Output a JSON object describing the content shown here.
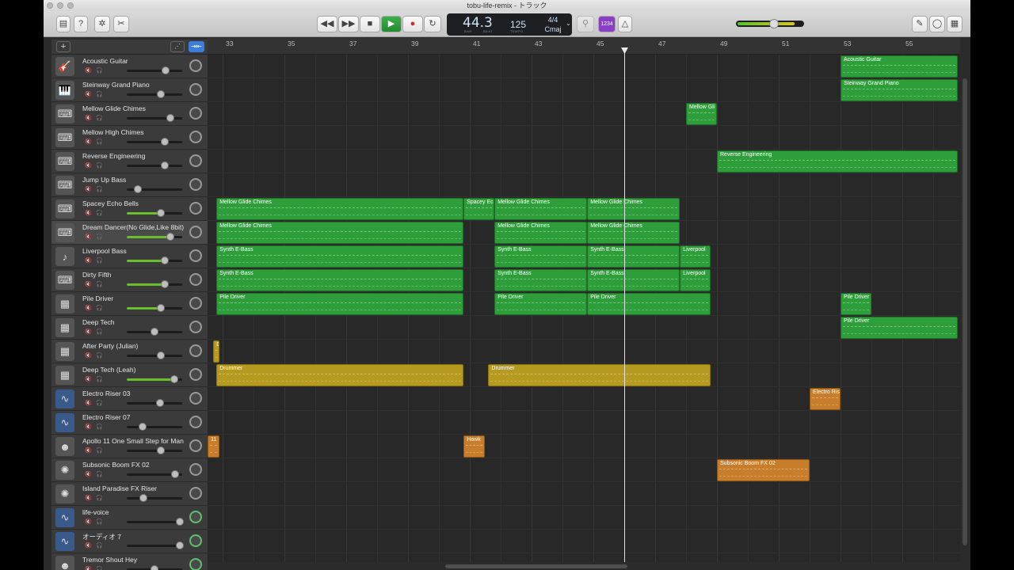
{
  "window": {
    "title": "tobu-life-remix - トラック"
  },
  "lcd": {
    "bar": "44.3",
    "bar_label": "BAR",
    "beat_label": "BEAT",
    "tempo": "125",
    "tempo_label": "TEMPO",
    "signature": "4/4",
    "key": "Cmaj"
  },
  "toolbar": {
    "counter_label": "1234"
  },
  "ruler": {
    "bars": [
      "33",
      "35",
      "37",
      "39",
      "41",
      "43",
      "45",
      "47",
      "49",
      "51",
      "53",
      "55"
    ]
  },
  "tracks": [
    {
      "name": "Acoustic Guitar",
      "icon": "guitar-icon",
      "vol": 0.7
    },
    {
      "name": "Steinway Grand Piano",
      "icon": "piano-icon",
      "vol": 0.62
    },
    {
      "name": "Mellow Glide Chimes",
      "icon": "synth-icon",
      "vol": 0.78
    },
    {
      "name": "Mellow High Chimes",
      "icon": "synth-icon",
      "vol": 0.68
    },
    {
      "name": "Reverse Engineering",
      "icon": "synth-icon",
      "vol": 0.68
    },
    {
      "name": "Jump Up Bass",
      "icon": "synth-icon",
      "vol": 0.2
    },
    {
      "name": "Spacey Echo Bells",
      "icon": "synth-icon",
      "vol": 0.62
    },
    {
      "name": "Dream Dancer(No Glide,Like 8bit)",
      "icon": "synth-icon",
      "vol": 0.78
    },
    {
      "name": "Liverpool Bass",
      "icon": "bass-icon",
      "vol": 0.68
    },
    {
      "name": "Dirty Fifth",
      "icon": "synth-icon",
      "vol": 0.68
    },
    {
      "name": "Pile Driver",
      "icon": "drum-machine-icon",
      "vol": 0.62
    },
    {
      "name": "Deep Tech",
      "icon": "drum-machine-icon",
      "vol": 0.5
    },
    {
      "name": "After Party (Julian)",
      "icon": "drum-machine-icon",
      "vol": 0.62
    },
    {
      "name": "Deep Tech (Leah)",
      "icon": "drum-machine-icon",
      "vol": 0.85
    },
    {
      "name": "Electro Riser 03",
      "icon": "waveform-icon",
      "vol": 0.6
    },
    {
      "name": "Electro Riser 07",
      "icon": "waveform-icon",
      "vol": 0.28
    },
    {
      "name": "Apollo 11 One Small Step for Man",
      "icon": "voice-icon",
      "vol": 0.62
    },
    {
      "name": "Subsonic Boom FX 02",
      "icon": "fx-icon",
      "vol": 0.87
    },
    {
      "name": "Island Paradise FX Riser",
      "icon": "fx-icon",
      "vol": 0.3
    },
    {
      "name": "life-voice",
      "icon": "waveform-icon",
      "vol": 0.95
    },
    {
      "name": "オーディオ 7",
      "icon": "waveform-icon",
      "vol": 0.95
    },
    {
      "name": "Tremor Shout Hey",
      "icon": "voice-icon",
      "vol": 0.5
    }
  ],
  "regions": [
    {
      "track": 0,
      "label": "Acoustic Guitar",
      "color": "green",
      "start": 53.0,
      "end": 56.8
    },
    {
      "track": 1,
      "label": "Steinway Grand Piano",
      "color": "green",
      "start": 53.0,
      "end": 56.8
    },
    {
      "track": 2,
      "label": "Mellow Gli",
      "color": "green",
      "start": 48.0,
      "end": 49.0
    },
    {
      "track": 4,
      "label": "Reverse Engineering",
      "color": "green",
      "start": 49.0,
      "end": 56.8
    },
    {
      "track": 6,
      "label": "Mellow Glide Chimes",
      "color": "green",
      "start": 32.8,
      "end": 40.8
    },
    {
      "track": 6,
      "label": "Spacey Ec",
      "color": "green",
      "start": 40.8,
      "end": 41.8
    },
    {
      "track": 6,
      "label": "Mellow Glide Chimes",
      "color": "green",
      "start": 41.8,
      "end": 44.8
    },
    {
      "track": 6,
      "label": "Mellow Glide Chimes",
      "color": "green",
      "start": 44.8,
      "end": 47.8
    },
    {
      "track": 7,
      "label": "Mellow Glide Chimes",
      "color": "green",
      "start": 32.8,
      "end": 40.8
    },
    {
      "track": 7,
      "label": "Mellow Glide Chimes",
      "color": "green",
      "start": 41.8,
      "end": 44.8
    },
    {
      "track": 7,
      "label": "Mellow Glide Chimes",
      "color": "green",
      "start": 44.8,
      "end": 47.8
    },
    {
      "track": 8,
      "label": "Synth E-Bass",
      "color": "green",
      "start": 32.8,
      "end": 40.8
    },
    {
      "track": 8,
      "label": "Synth E-Bass",
      "color": "green",
      "start": 41.8,
      "end": 44.8
    },
    {
      "track": 8,
      "label": "Synth E-Bass",
      "color": "green",
      "start": 44.8,
      "end": 47.8
    },
    {
      "track": 8,
      "label": "Liverpool",
      "color": "green",
      "start": 47.8,
      "end": 48.8
    },
    {
      "track": 9,
      "label": "Synth E-Bass",
      "color": "green",
      "start": 32.8,
      "end": 40.8
    },
    {
      "track": 9,
      "label": "Synth E-Bass",
      "color": "green",
      "start": 41.8,
      "end": 44.8
    },
    {
      "track": 9,
      "label": "Synth E-Bass",
      "color": "green",
      "start": 44.8,
      "end": 47.8
    },
    {
      "track": 9,
      "label": "Liverpool",
      "color": "green",
      "start": 47.8,
      "end": 48.8
    },
    {
      "track": 10,
      "label": "Pile Driver",
      "color": "green",
      "start": 32.8,
      "end": 40.8
    },
    {
      "track": 10,
      "label": "Pile Driver",
      "color": "green",
      "start": 41.8,
      "end": 44.8
    },
    {
      "track": 10,
      "label": "Pile Driver",
      "color": "green",
      "start": 44.8,
      "end": 48.8
    },
    {
      "track": 10,
      "label": "Pile Driver",
      "color": "green",
      "start": 53.0,
      "end": 54.0
    },
    {
      "track": 11,
      "label": "Pile Driver",
      "color": "green",
      "start": 53.0,
      "end": 56.8
    },
    {
      "track": 12,
      "label": "D",
      "color": "yellow",
      "start": 32.7,
      "end": 32.9
    },
    {
      "track": 13,
      "label": "Drummer",
      "color": "yellow",
      "start": 32.8,
      "end": 40.8
    },
    {
      "track": 13,
      "label": "Drummer",
      "color": "yellow",
      "start": 41.6,
      "end": 48.8
    },
    {
      "track": 14,
      "label": "Electro Ris",
      "color": "orange",
      "start": 52.0,
      "end": 53.0
    },
    {
      "track": 16,
      "label": "11",
      "color": "orange",
      "start": 32.5,
      "end": 32.9
    },
    {
      "track": 16,
      "label": "Hawk",
      "color": "orange",
      "start": 40.8,
      "end": 41.5
    },
    {
      "track": 17,
      "label": "Subsonic Boom FX 02",
      "color": "orange",
      "start": 49.0,
      "end": 52.0
    }
  ]
}
